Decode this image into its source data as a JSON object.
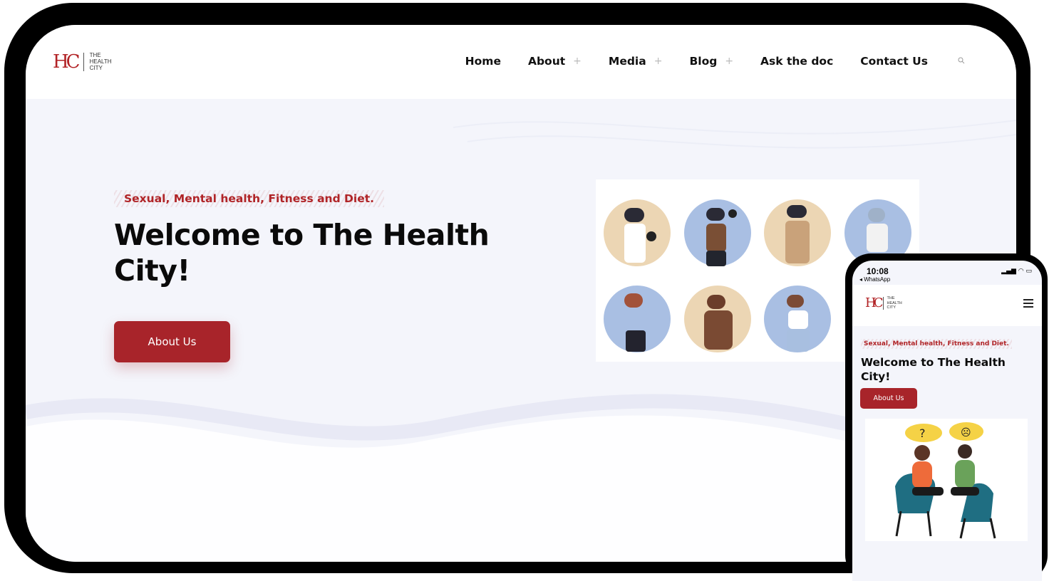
{
  "desktop": {
    "logo": {
      "mark": "HC",
      "line1": "THE",
      "line2": "HEALTH",
      "line3": "CITY"
    },
    "nav": {
      "items": [
        {
          "label": "Home",
          "has_submenu": false
        },
        {
          "label": "About",
          "has_submenu": true
        },
        {
          "label": "Media",
          "has_submenu": true
        },
        {
          "label": "Blog",
          "has_submenu": true
        },
        {
          "label": "Ask the doc",
          "has_submenu": false
        },
        {
          "label": "Contact Us",
          "has_submenu": false
        }
      ],
      "submenu_symbol": "+",
      "search_icon": "search-icon"
    },
    "hero": {
      "tagline": "Sexual, Mental health, Fitness and Diet.",
      "headline": "Welcome to The Health City!",
      "button_label": "About Us"
    },
    "illustration": "fitness-people-illustration"
  },
  "mobile": {
    "status": {
      "time": "10:08",
      "back_app": "◂ WhatsApp",
      "icons": "▂▄▆ ◠ ▭"
    },
    "logo": {
      "mark": "HC",
      "line1": "THE",
      "line2": "HEALTH",
      "line3": "CITY"
    },
    "menu_icon": "hamburger-icon",
    "hero": {
      "tagline": "Sexual, Mental health, Fitness and Diet.",
      "headline": "Welcome to The Health City!",
      "button_label": "About Us"
    },
    "illustration": "mental-health-conversation-illustration",
    "bubble_left": "?",
    "bubble_right": "☹"
  },
  "colors": {
    "brand_red": "#a8242a",
    "page_bg": "#f4f5fb",
    "frame": "#000000"
  }
}
